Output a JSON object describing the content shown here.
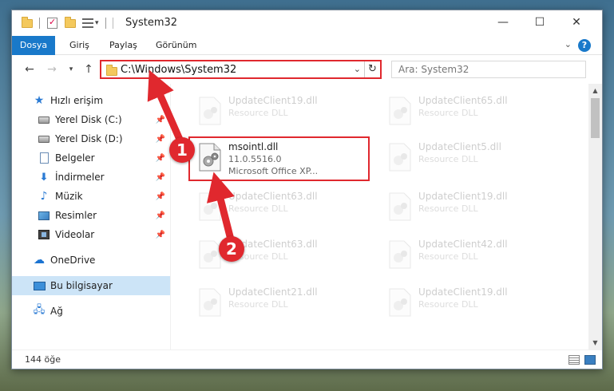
{
  "window": {
    "title": "System32"
  },
  "ribbon": {
    "tabs": [
      {
        "label": "Dosya"
      },
      {
        "label": "Giriş"
      },
      {
        "label": "Paylaş"
      },
      {
        "label": "Görünüm"
      }
    ]
  },
  "address": {
    "path": "C:\\Windows\\System32"
  },
  "search": {
    "placeholder": "Ara: System32"
  },
  "sidebar": {
    "items": [
      {
        "label": "Hızlı erişim",
        "icon": "star-icon"
      },
      {
        "label": "Yerel Disk (C:)",
        "icon": "drive-icon"
      },
      {
        "label": "Yerel Disk (D:)",
        "icon": "drive-icon"
      },
      {
        "label": "Belgeler",
        "icon": "documents-icon"
      },
      {
        "label": "İndirmeler",
        "icon": "downloads-icon"
      },
      {
        "label": "Müzik",
        "icon": "music-icon"
      },
      {
        "label": "Resimler",
        "icon": "pictures-icon"
      },
      {
        "label": "Videolar",
        "icon": "videos-icon"
      },
      {
        "label": "OneDrive",
        "icon": "cloud-icon"
      },
      {
        "label": "Bu bilgisayar",
        "icon": "computer-icon"
      },
      {
        "label": "Ağ",
        "icon": "network-icon"
      }
    ]
  },
  "files": {
    "left": [
      {
        "name": "UpdateClient19.dll",
        "desc": "Resource DLL"
      },
      {
        "name": "msointl.dll",
        "version": "11.0.5516.0",
        "desc": "Microsoft Office XP..."
      },
      {
        "name": "UpdateClient63.dll",
        "desc": "Resource DLL"
      },
      {
        "name": "UpdateClient63.dll",
        "desc": "Resource DLL"
      },
      {
        "name": "UpdateClient21.dll",
        "desc": "Resource DLL"
      }
    ],
    "right": [
      {
        "name": "UpdateClient65.dll",
        "desc": "Resource DLL"
      },
      {
        "name": "UpdateClient5.dll",
        "desc": "Resource DLL"
      },
      {
        "name": "UpdateClient19.dll",
        "desc": "Resource DLL"
      },
      {
        "name": "UpdateClient42.dll",
        "desc": "Resource DLL"
      },
      {
        "name": "UpdateClient19.dll",
        "desc": "Resource DLL"
      }
    ]
  },
  "status": {
    "count": "144 öğe"
  },
  "annotations": {
    "step1": "1",
    "step2": "2",
    "color": "#e0282e"
  }
}
